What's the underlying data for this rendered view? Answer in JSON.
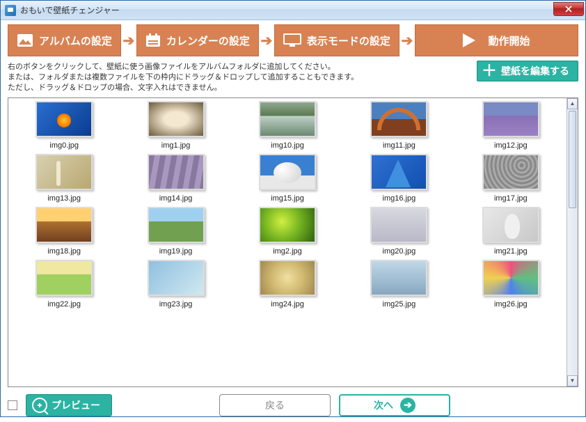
{
  "window": {
    "title": "おもいで壁紙チェンジャー"
  },
  "steps": {
    "album": "アルバムの設定",
    "calendar": "カレンダーの設定",
    "display": "表示モードの設定",
    "start": "動作開始"
  },
  "help": {
    "line1": "右のボタンをクリックして、壁紙に使う画像ファイルをアルバムフォルダに追加してください。",
    "line2": "または、フォルダまたは複数ファイルを下の枠内にドラッグ＆ドロップして追加することもできます。",
    "line3": "ただし、ドラッグ＆ドロップの場合、文字入れはできません。"
  },
  "edit_button": "壁紙を編集する",
  "items": [
    {
      "name": "img0.jpg",
      "cls": "t0"
    },
    {
      "name": "img1.jpg",
      "cls": "t1"
    },
    {
      "name": "img10.jpg",
      "cls": "t2"
    },
    {
      "name": "img11.jpg",
      "cls": "t3"
    },
    {
      "name": "img12.jpg",
      "cls": "t4"
    },
    {
      "name": "img13.jpg",
      "cls": "t5"
    },
    {
      "name": "img14.jpg",
      "cls": "t6"
    },
    {
      "name": "img15.jpg",
      "cls": "t7"
    },
    {
      "name": "img16.jpg",
      "cls": "t8"
    },
    {
      "name": "img17.jpg",
      "cls": "t9"
    },
    {
      "name": "img18.jpg",
      "cls": "t10"
    },
    {
      "name": "img19.jpg",
      "cls": "t11"
    },
    {
      "name": "img2.jpg",
      "cls": "t12"
    },
    {
      "name": "img20.jpg",
      "cls": "t13"
    },
    {
      "name": "img21.jpg",
      "cls": "t14"
    },
    {
      "name": "img22.jpg",
      "cls": "t15"
    },
    {
      "name": "img23.jpg",
      "cls": "t16"
    },
    {
      "name": "img24.jpg",
      "cls": "t17"
    },
    {
      "name": "img25.jpg",
      "cls": "t18"
    },
    {
      "name": "img26.jpg",
      "cls": "t19"
    }
  ],
  "bottom": {
    "preview": "プレビュー",
    "back": "戻る",
    "next": "次へ"
  }
}
